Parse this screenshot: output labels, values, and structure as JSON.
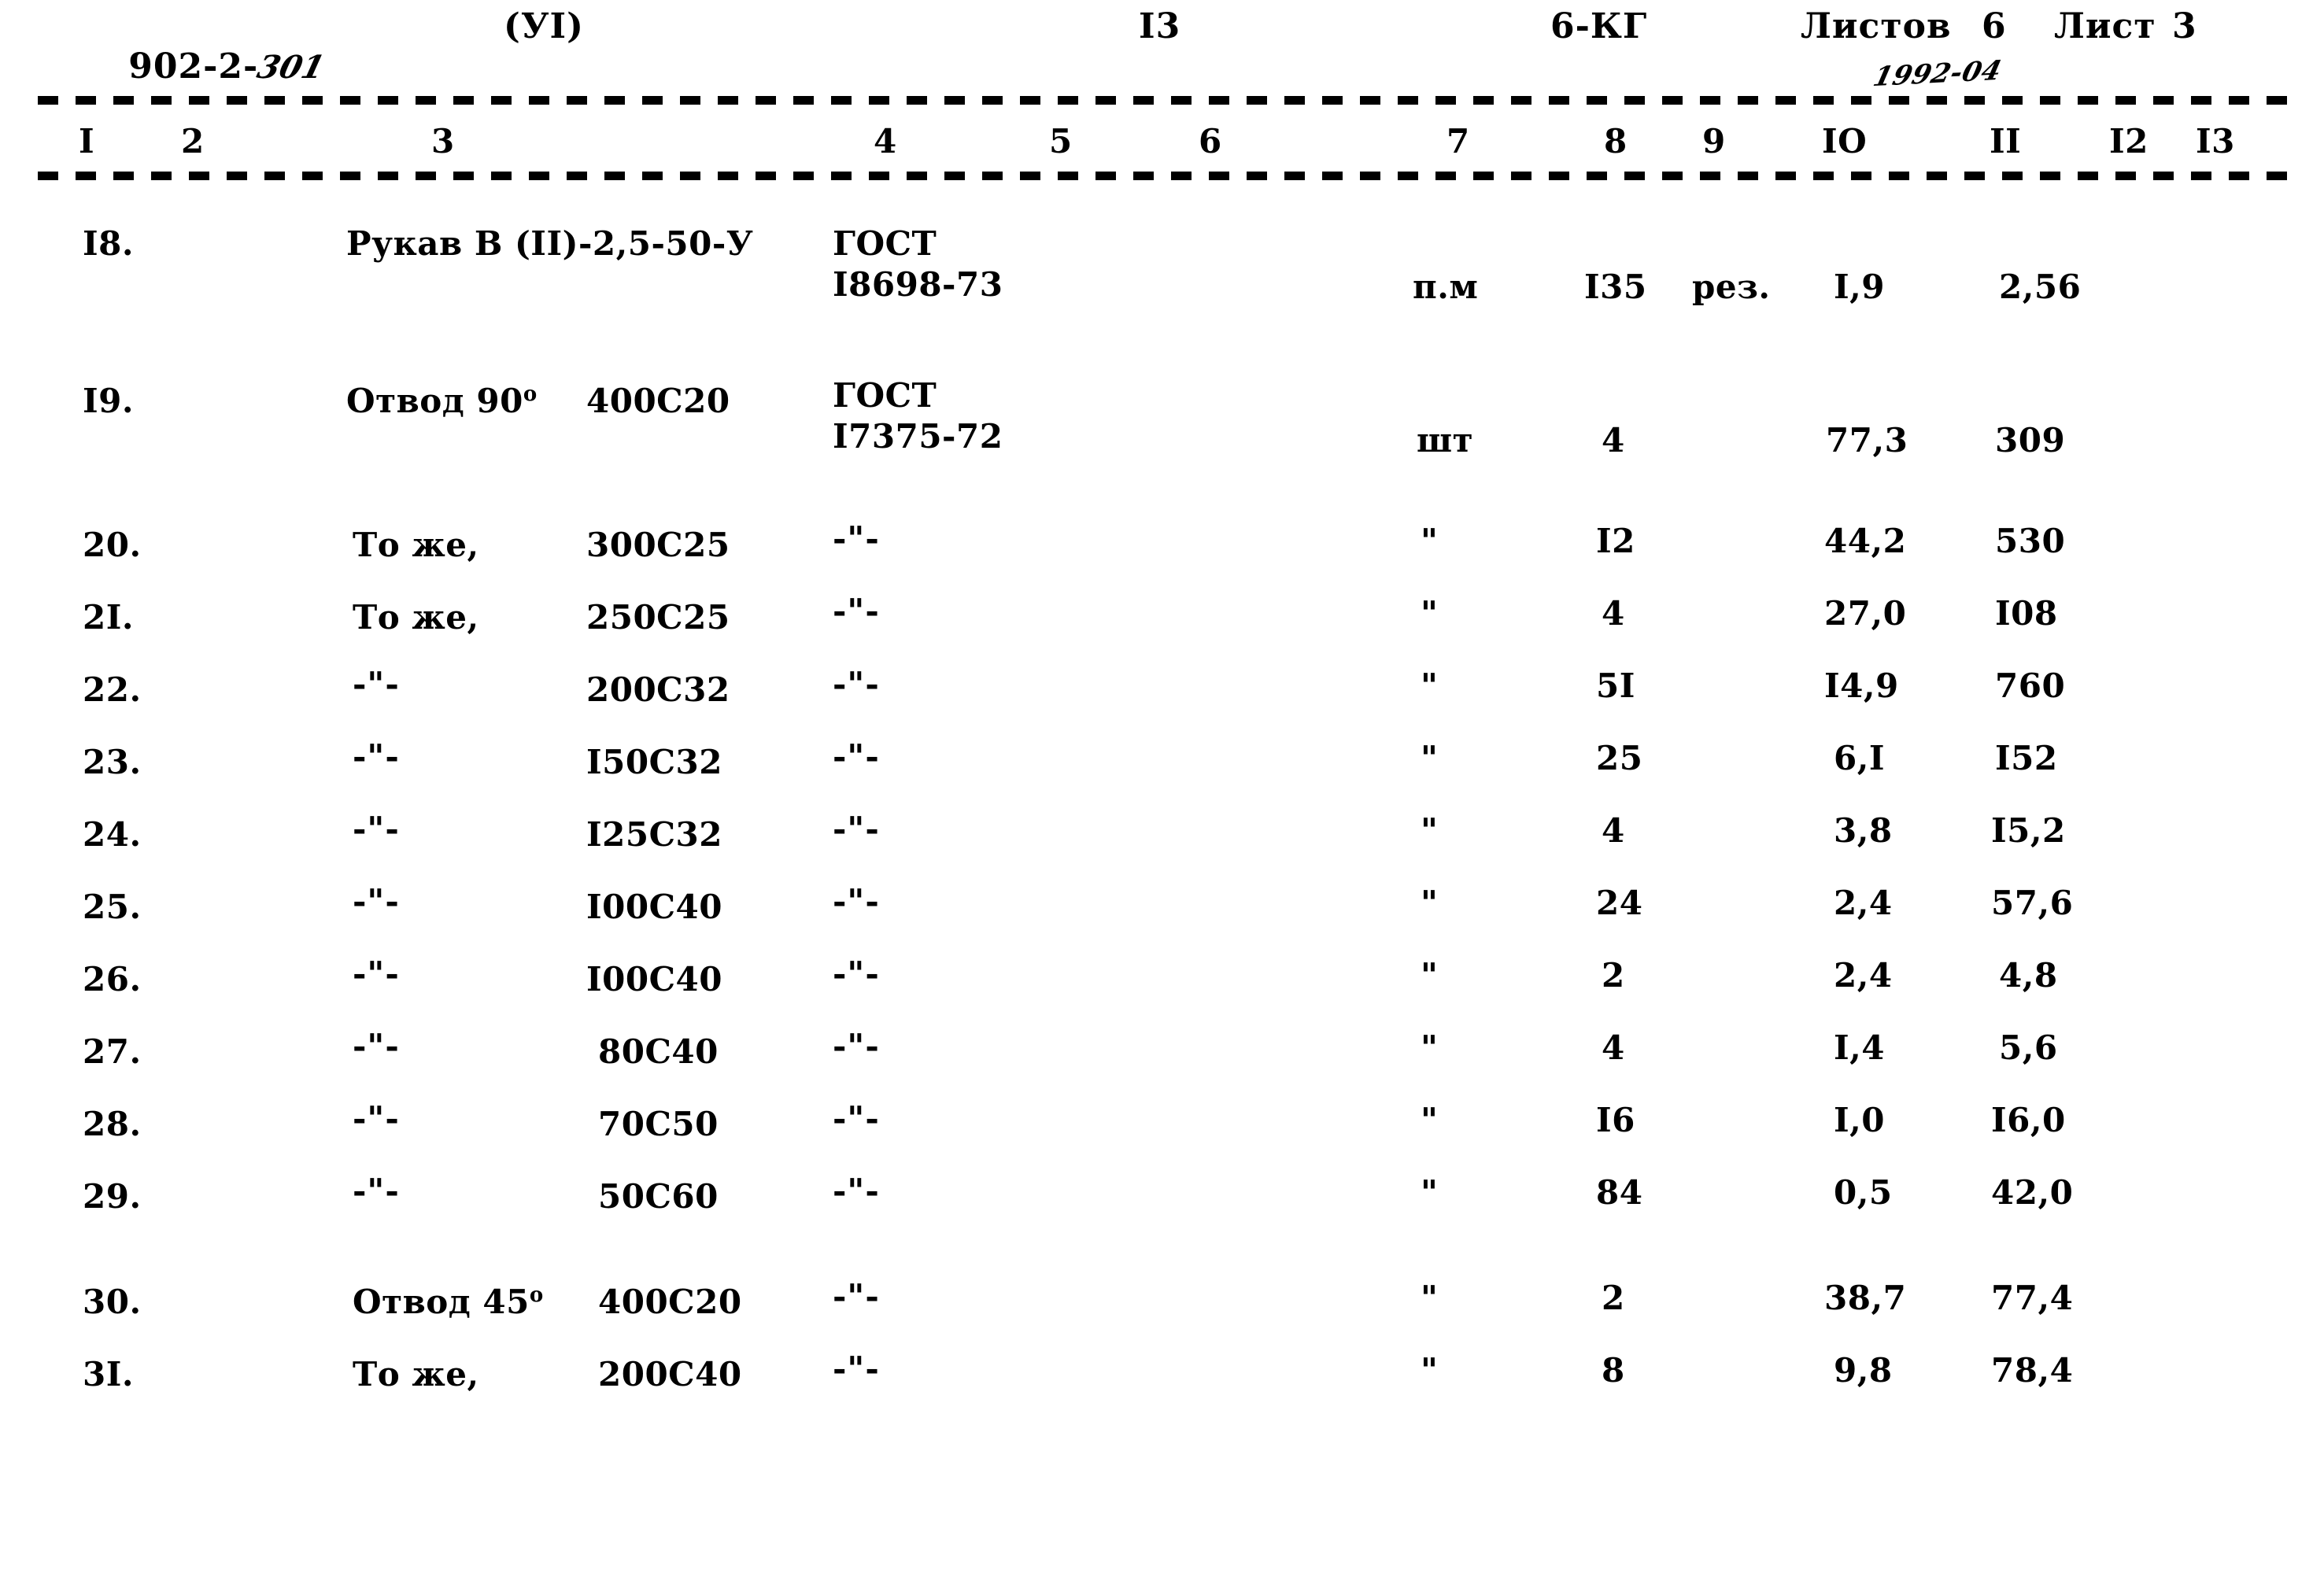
{
  "header": {
    "doc_code_printed": "902-2-",
    "doc_code_hand": "301",
    "section": "(УI)",
    "page_center": "I3",
    "mark": "6-КГ",
    "sheets_label": "Листов",
    "sheets_count": "6",
    "sheet_label": "Лист",
    "sheet_number": "3",
    "hand_annotation": "1992-04"
  },
  "column_numbers": [
    "I",
    "2",
    "3",
    "4",
    "5",
    "6",
    "7",
    "8",
    "9",
    "IO",
    "II",
    "I2",
    "I3"
  ],
  "rows": [
    {
      "c1": "I8.",
      "c3_name": "Рукав В (II)-2,5-50-У",
      "c3_size": "",
      "c4": "ГОСТ",
      "c4b": "I8698-73",
      "c7": "п.м",
      "c8": "I35",
      "c9": "рез.",
      "c10": "I,9",
      "c11": "2,56"
    },
    {
      "c1": "I9.",
      "c3_name": "Отвод 90",
      "c3_deg": "о",
      "c3_size": "400С20",
      "c4": "ГОСТ",
      "c4b": "I7375-72",
      "c7": "шт",
      "c8": "4",
      "c9": "",
      "c10": "77,3",
      "c11": "309"
    },
    {
      "c1": "20.",
      "c3_name": "То же,",
      "c3_deg": "",
      "c3_size": "300С25",
      "c4": "-\"-",
      "c4b": "",
      "c7": "\"",
      "c8": "I2",
      "c9": "",
      "c10": "44,2",
      "c11": "530"
    },
    {
      "c1": "2I.",
      "c3_name": "То же,",
      "c3_deg": "",
      "c3_size": "250С25",
      "c4": "-\"-",
      "c4b": "",
      "c7": "\"",
      "c8": "4",
      "c9": "",
      "c10": "27,0",
      "c11": "I08"
    },
    {
      "c1": "22.",
      "c3_name": "-\"-",
      "c3_deg": "",
      "c3_size": "200С32",
      "c4": "-\"-",
      "c4b": "",
      "c7": "\"",
      "c8": "5I",
      "c9": "",
      "c10": "I4,9",
      "c11": "760"
    },
    {
      "c1": "23.",
      "c3_name": "-\"-",
      "c3_deg": "",
      "c3_size": "I50С32",
      "c4": "-\"-",
      "c4b": "",
      "c7": "\"",
      "c8": "25",
      "c9": "",
      "c10": "6,I",
      "c11": "I52"
    },
    {
      "c1": "24.",
      "c3_name": "-\"-",
      "c3_deg": "",
      "c3_size": "I25С32",
      "c4": "-\"-",
      "c4b": "",
      "c7": "\"",
      "c8": "4",
      "c9": "",
      "c10": "3,8",
      "c11": "I5,2"
    },
    {
      "c1": "25.",
      "c3_name": "-\"-",
      "c3_deg": "",
      "c3_size": "I00С40",
      "c4": "-\"-",
      "c4b": "",
      "c7": "\"",
      "c8": "24",
      "c9": "",
      "c10": "2,4",
      "c11": "57,6"
    },
    {
      "c1": "26.",
      "c3_name": "-\"-",
      "c3_deg": "",
      "c3_size": "I00С40",
      "c4": "-\"-",
      "c4b": "",
      "c7": "\"",
      "c8": "2",
      "c9": "",
      "c10": "2,4",
      "c11": "4,8"
    },
    {
      "c1": "27.",
      "c3_name": "-\"-",
      "c3_deg": "",
      "c3_size": "80С40",
      "c4": "-\"-",
      "c4b": "",
      "c7": "\"",
      "c8": "4",
      "c9": "",
      "c10": "I,4",
      "c11": "5,6"
    },
    {
      "c1": "28.",
      "c3_name": "-\"-",
      "c3_deg": "",
      "c3_size": "70С50",
      "c4": "-\"-",
      "c4b": "",
      "c7": "\"",
      "c8": "I6",
      "c9": "",
      "c10": "I,0",
      "c11": "I6,0"
    },
    {
      "c1": "29.",
      "c3_name": "-\"-",
      "c3_deg": "",
      "c3_size": "50С60",
      "c4": "-\"-",
      "c4b": "",
      "c7": "\"",
      "c8": "84",
      "c9": "",
      "c10": "0,5",
      "c11": "42,0"
    },
    {
      "c1": "30.",
      "c3_name": "Отвод 45",
      "c3_deg": "о",
      "c3_size": "400С20",
      "c4": "-\"-",
      "c4b": "",
      "c7": "\"",
      "c8": "2",
      "c9": "",
      "c10": "38,7",
      "c11": "77,4"
    },
    {
      "c1": "3I.",
      "c3_name": "То же,",
      "c3_deg": "",
      "c3_size": "200С40",
      "c4": "-\"-",
      "c4b": "",
      "c7": "\"",
      "c8": "8",
      "c9": "",
      "c10": "9,8",
      "c11": "78,4"
    }
  ]
}
